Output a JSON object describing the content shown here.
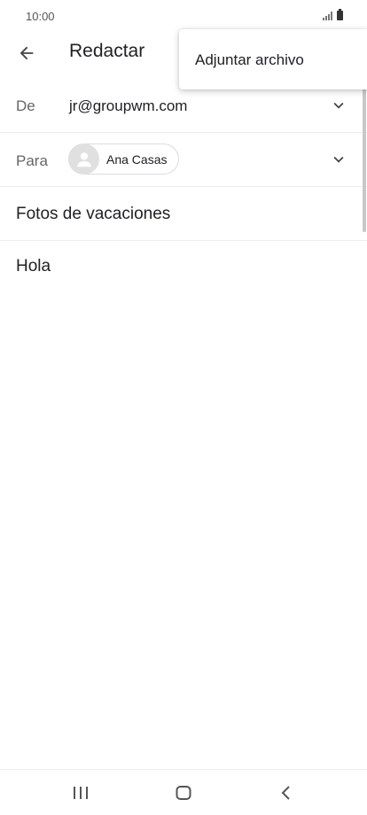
{
  "status_bar": {
    "time": "10:00"
  },
  "app_bar": {
    "title": "Redactar",
    "back_icon": "arrow-back-icon"
  },
  "menu": {
    "items": [
      {
        "label": "Adjuntar archivo"
      }
    ]
  },
  "compose": {
    "from": {
      "label": "De",
      "value": "jr@groupwm.com"
    },
    "to": {
      "label": "Para",
      "recipients": [
        {
          "name": "Ana Casas"
        }
      ]
    },
    "subject": "Fotos de vacaciones",
    "body": "Hola"
  },
  "nav_bar": {
    "icons": [
      "recent-apps-icon",
      "home-icon",
      "back-icon"
    ]
  },
  "colors": {
    "text": "#202124",
    "label": "#666666",
    "divider": "#ececec"
  }
}
